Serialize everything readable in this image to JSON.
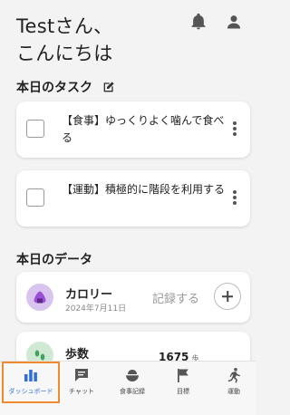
{
  "greeting": {
    "line1": "Testさん、",
    "line2": "こんにちは"
  },
  "header": {
    "bell_icon": "bell-icon",
    "profile_icon": "person-icon"
  },
  "tasks": {
    "section_title": "本日のタスク",
    "edit_icon": "edit-icon",
    "items": [
      {
        "text": "【食事】ゆっくりよく噛んで食べる"
      },
      {
        "text": "【運動】積極的に階段を利用する"
      }
    ]
  },
  "data_section": {
    "section_title": "本日のデータ",
    "calorie": {
      "label": "カロリー",
      "date": "2024年7月11日",
      "record_label": "記録する",
      "icon": "onigiri-icon",
      "icon_color": "#d8c5ef"
    },
    "steps": {
      "label": "歩数",
      "value": "1675",
      "unit": "歩",
      "icon": "footprints-icon",
      "icon_color": "#cfe9d4"
    }
  },
  "tabbar": {
    "active_color": "#2f6fd6",
    "items": [
      {
        "label": "ダッシュボード",
        "icon": "bar-chart-icon",
        "active": true
      },
      {
        "label": "チャット",
        "icon": "chat-icon"
      },
      {
        "label": "食事記録",
        "icon": "meal-icon"
      },
      {
        "label": "目標",
        "icon": "flag-icon"
      },
      {
        "label": "運動",
        "icon": "running-icon"
      }
    ]
  }
}
